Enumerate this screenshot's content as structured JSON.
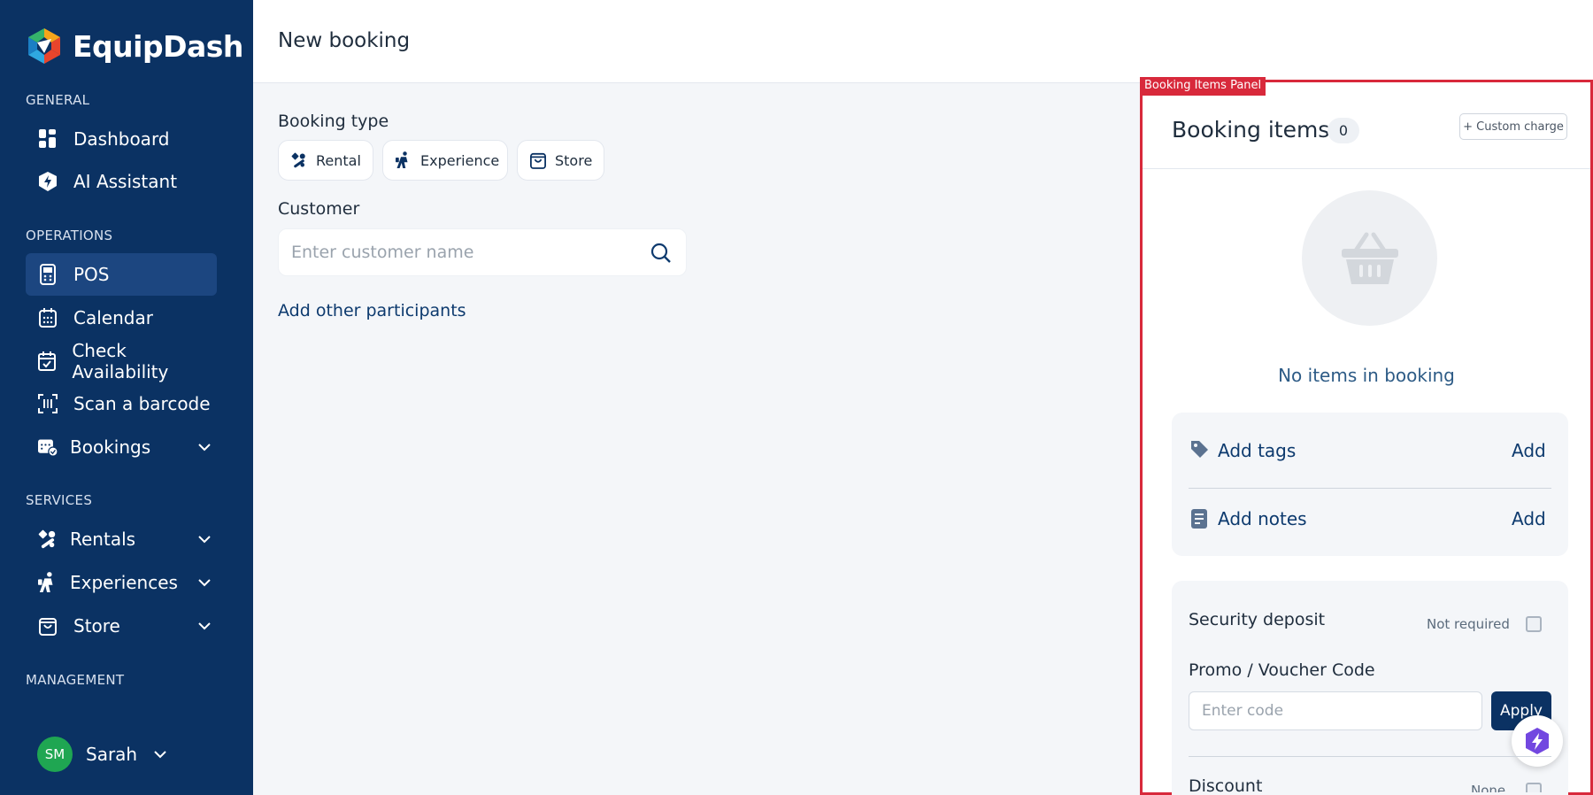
{
  "app": {
    "name": "EquipDash"
  },
  "colors": {
    "sidebar": "#0b3263",
    "accent": "#0d3a6e",
    "highlight": "#d8293b",
    "avatar": "#1fa652"
  },
  "sidebar": {
    "sections": {
      "general": "GENERAL",
      "operations": "OPERATIONS",
      "services": "SERVICES",
      "management": "MANAGEMENT"
    },
    "general_items": [
      {
        "label": "Dashboard",
        "icon": "grid-icon"
      },
      {
        "label": "AI Assistant",
        "icon": "ai-shield-icon"
      }
    ],
    "operations_items": [
      {
        "label": "POS",
        "icon": "pos-terminal-icon",
        "active": true
      },
      {
        "label": "Calendar",
        "icon": "calendar-icon"
      },
      {
        "label": "Check Availability",
        "icon": "calendar-check-icon"
      },
      {
        "label": "Scan a barcode",
        "icon": "barcode-scan-icon"
      },
      {
        "label": "Bookings",
        "icon": "calendar-bookings-icon"
      }
    ],
    "services_items": [
      {
        "label": "Rentals",
        "icon": "rental-icon"
      },
      {
        "label": "Experiences",
        "icon": "experience-icon"
      },
      {
        "label": "Store",
        "icon": "shopping-bag-icon"
      }
    ],
    "user": {
      "initials": "SM",
      "name": "Sarah"
    }
  },
  "header": {
    "title": "New booking"
  },
  "form": {
    "booking_type_label": "Booking type",
    "booking_types": [
      "Rental",
      "Experience",
      "Store"
    ],
    "customer_label": "Customer",
    "customer_placeholder": "Enter customer name",
    "add_participants": "Add other participants"
  },
  "panel": {
    "tag": "Booking Items Panel",
    "title": "Booking items",
    "count": "0",
    "custom_charge": "+ Custom charge",
    "empty_text": "No items in booking",
    "tags_label": "Add tags",
    "tags_action": "Add",
    "notes_label": "Add notes",
    "notes_action": "Add",
    "security_deposit_label": "Security deposit",
    "security_deposit_status": "Not required",
    "promo_label": "Promo / Voucher Code",
    "promo_placeholder": "Enter code",
    "apply_label": "Apply",
    "discount_label": "Discount",
    "discount_status": "None"
  }
}
